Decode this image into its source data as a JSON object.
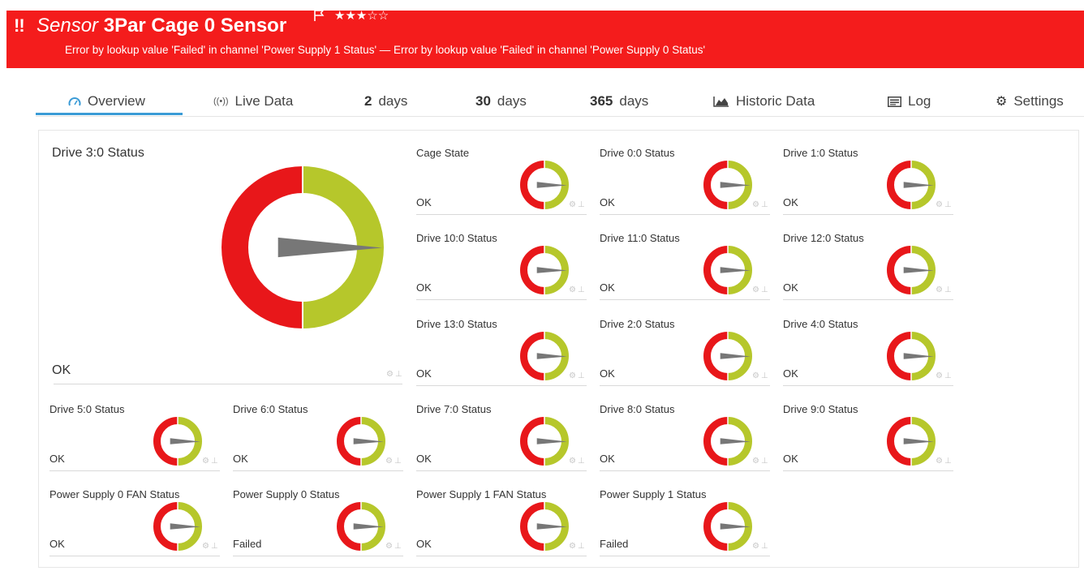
{
  "header": {
    "alert_marker": "!!",
    "kind": "Sensor",
    "name": "3Par Cage 0 Sensor",
    "stars": "★★★☆☆",
    "message": "Error by lookup value 'Failed' in channel 'Power Supply 1 Status' — Error by lookup value 'Failed' in channel 'Power Supply 0 Status'",
    "bg_color": "#f41c1c"
  },
  "tabs": [
    {
      "label": "Overview",
      "icon": "gauge-icon",
      "active": true
    },
    {
      "label": "Live Data",
      "icon": "broadcast-icon"
    },
    {
      "number": "2",
      "label": "days"
    },
    {
      "number": "30",
      "label": "days"
    },
    {
      "number": "365",
      "label": "days"
    },
    {
      "label": "Historic Data",
      "icon": "area-chart-icon"
    },
    {
      "label": "Log",
      "icon": "log-icon"
    },
    {
      "label": "Settings",
      "icon": "gear-icon"
    }
  ],
  "gauges": {
    "main": {
      "name": "Drive 3:0 Status",
      "value": "OK"
    },
    "cage_state": {
      "name": "Cage State",
      "value": "OK"
    },
    "drive_0": {
      "name": "Drive 0:0 Status",
      "value": "OK"
    },
    "drive_1": {
      "name": "Drive 1:0 Status",
      "value": "OK"
    },
    "drive_10": {
      "name": "Drive 10:0 Status",
      "value": "OK"
    },
    "drive_11": {
      "name": "Drive 11:0 Status",
      "value": "OK"
    },
    "drive_12": {
      "name": "Drive 12:0 Status",
      "value": "OK"
    },
    "drive_13": {
      "name": "Drive 13:0 Status",
      "value": "OK"
    },
    "drive_2": {
      "name": "Drive 2:0 Status",
      "value": "OK"
    },
    "drive_4": {
      "name": "Drive 4:0 Status",
      "value": "OK"
    },
    "drive_5": {
      "name": "Drive 5:0 Status",
      "value": "OK"
    },
    "drive_6": {
      "name": "Drive 6:0 Status",
      "value": "OK"
    },
    "drive_7": {
      "name": "Drive 7:0 Status",
      "value": "OK"
    },
    "drive_8": {
      "name": "Drive 8:0 Status",
      "value": "OK"
    },
    "drive_9": {
      "name": "Drive 9:0 Status",
      "value": "OK"
    },
    "ps0_fan": {
      "name": "Power Supply 0 FAN Status",
      "value": "OK"
    },
    "ps0": {
      "name": "Power Supply 0 Status",
      "value": "Failed"
    },
    "ps1_fan": {
      "name": "Power Supply 1 FAN Status",
      "value": "OK"
    },
    "ps1": {
      "name": "Power Supply 1 Status",
      "value": "Failed"
    }
  },
  "colors": {
    "gauge_ok": "#b6c72b",
    "gauge_error": "#e8171a",
    "needle": "#777777",
    "active_tab": "#3a9bd6"
  }
}
